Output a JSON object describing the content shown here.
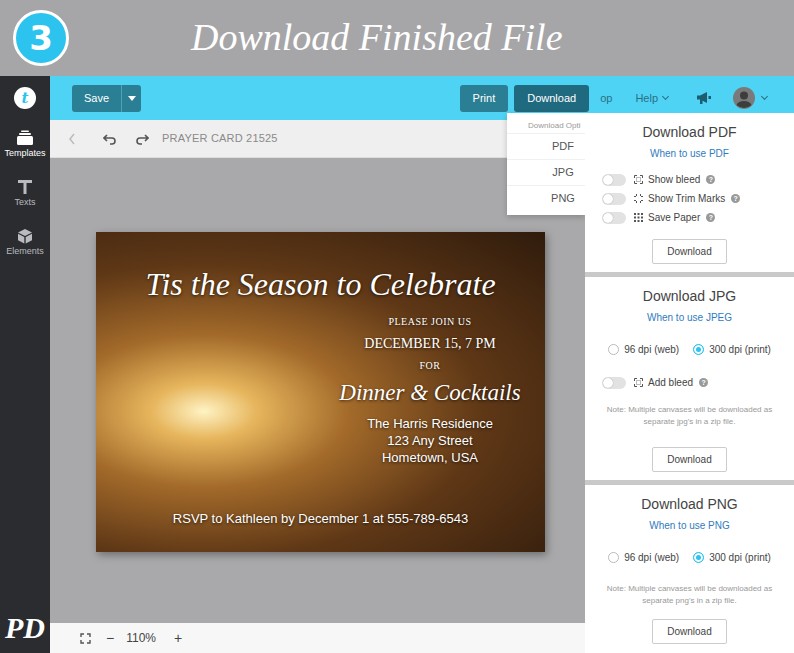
{
  "banner": {
    "step": "3",
    "title": "Download Finished File"
  },
  "sidebar": {
    "logo": "t",
    "items": [
      {
        "label": "Templates",
        "selected": true
      },
      {
        "label": "Texts",
        "selected": false
      },
      {
        "label": "Elements",
        "selected": false
      }
    ],
    "watermark": "PD"
  },
  "topbar": {
    "save": {
      "label": "Save"
    },
    "buttons": [
      {
        "label": "Print",
        "selected": false
      },
      {
        "label": "Download",
        "selected": true
      }
    ],
    "cut_label": "op",
    "help": "Help"
  },
  "document": {
    "title": "PRAYER CARD 21525"
  },
  "zoom": {
    "out": "−",
    "level": "110%",
    "in": "+"
  },
  "design": {
    "lines": [
      {
        "text": "Tis the Season to Celebrate",
        "kind": "headline"
      },
      {
        "text": "PLEASE JOIN US",
        "kind": "small-caps"
      },
      {
        "text": "DECEMBER 15, 7 PM",
        "kind": "caps"
      },
      {
        "text": "FOR",
        "kind": "small-caps"
      },
      {
        "text": "Dinner & Cocktails",
        "kind": "script"
      },
      {
        "text": "The Harris Residence",
        "kind": "body"
      },
      {
        "text": "123 Any Street",
        "kind": "body"
      },
      {
        "text": "Hometown, USA",
        "kind": "body"
      },
      {
        "text": "RSVP to Kathleen by December 1 at 555-789-6543",
        "kind": "footer"
      }
    ]
  },
  "dropdown": {
    "header": "Download Opti",
    "items": [
      {
        "label": "PDF"
      },
      {
        "label": "JPG"
      },
      {
        "label": "PNG"
      }
    ]
  },
  "panels": [
    {
      "title": "Download PDF",
      "help_link": "When to use PDF",
      "toggles": [
        {
          "label": "Show bleed",
          "on": false,
          "help": "?"
        },
        {
          "label": "Show Trim Marks",
          "on": false,
          "help": "?"
        },
        {
          "label": "Save Paper",
          "on": false,
          "help": "?"
        }
      ],
      "button": "Download"
    },
    {
      "title": "Download JPG",
      "help_link": "When to use JPEG",
      "dpi": [
        {
          "label": "96 dpi (web)",
          "selected": false
        },
        {
          "label": "300 dpi (print)",
          "selected": true
        }
      ],
      "toggles": [
        {
          "label": "Add bleed",
          "on": false,
          "help": "?"
        }
      ],
      "note": "Note: Multiple canvases will be downloaded as separate jpg's in a zip file.",
      "button": "Download"
    },
    {
      "title": "Download PNG",
      "help_link": "When to use PNG",
      "dpi": [
        {
          "label": "96 dpi (web)",
          "selected": false
        },
        {
          "label": "300 dpi (print)",
          "selected": true
        }
      ],
      "note": "Note: Multiple canvases will be downloaded as separate png's in a zip file.",
      "button": "Download"
    }
  ]
}
